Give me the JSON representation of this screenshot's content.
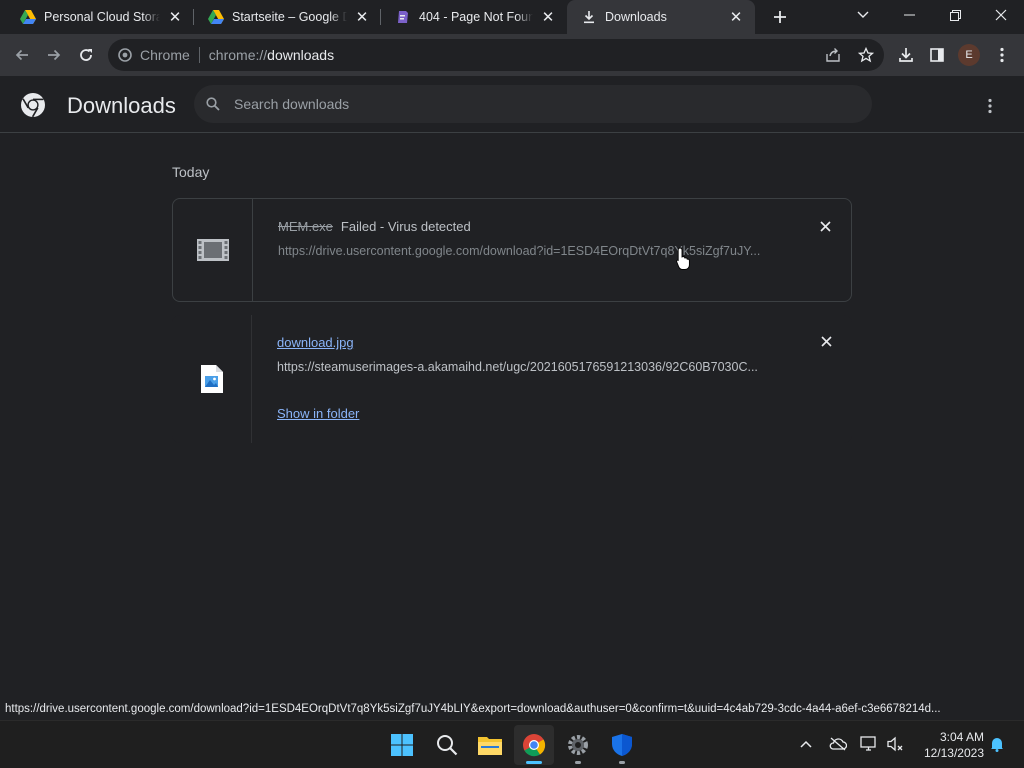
{
  "tabs": [
    {
      "title": "Personal Cloud Storage",
      "icon": "google-drive-icon",
      "active": false
    },
    {
      "title": "Startseite – Google Drive",
      "icon": "google-drive-icon",
      "active": false
    },
    {
      "title": "404 - Page Not Found",
      "icon": "page-icon",
      "active": false
    },
    {
      "title": "Downloads",
      "icon": "download-icon",
      "active": true
    }
  ],
  "omnibox": {
    "site_label": "Chrome",
    "scheme": "chrome://",
    "host": "downloads"
  },
  "page": {
    "title": "Downloads",
    "search_placeholder": "Search downloads",
    "section_today": "Today"
  },
  "downloads": [
    {
      "filename": "MEM.exe",
      "status": "Failed - Virus detected",
      "url": "https://drive.usercontent.google.com/download?id=1ESD4EOrqDtVt7q8Yk5siZgf7uJY...",
      "file_icon": "film-icon"
    },
    {
      "filename": "download.jpg",
      "url": "https://steamuserimages-a.akamaihd.net/ugc/2021605176591213036/92C60B7030C...",
      "action": "Show in folder",
      "file_icon": "image-file-icon"
    }
  ],
  "status_url": "https://drive.usercontent.google.com/download?id=1ESD4EOrqDtVt7q8Yk5siZgf7uJY4bLIY&export=download&authuser=0&confirm=t&uuid=4c4ab729-3cdc-4a44-a6ef-c3e6678214d...",
  "profile_initial": "E",
  "clock": {
    "time": "3:04 AM",
    "date": "12/13/2023"
  },
  "colors": {
    "accent": "#8ab4f8",
    "background": "#202124",
    "toolbar": "#35363a"
  }
}
